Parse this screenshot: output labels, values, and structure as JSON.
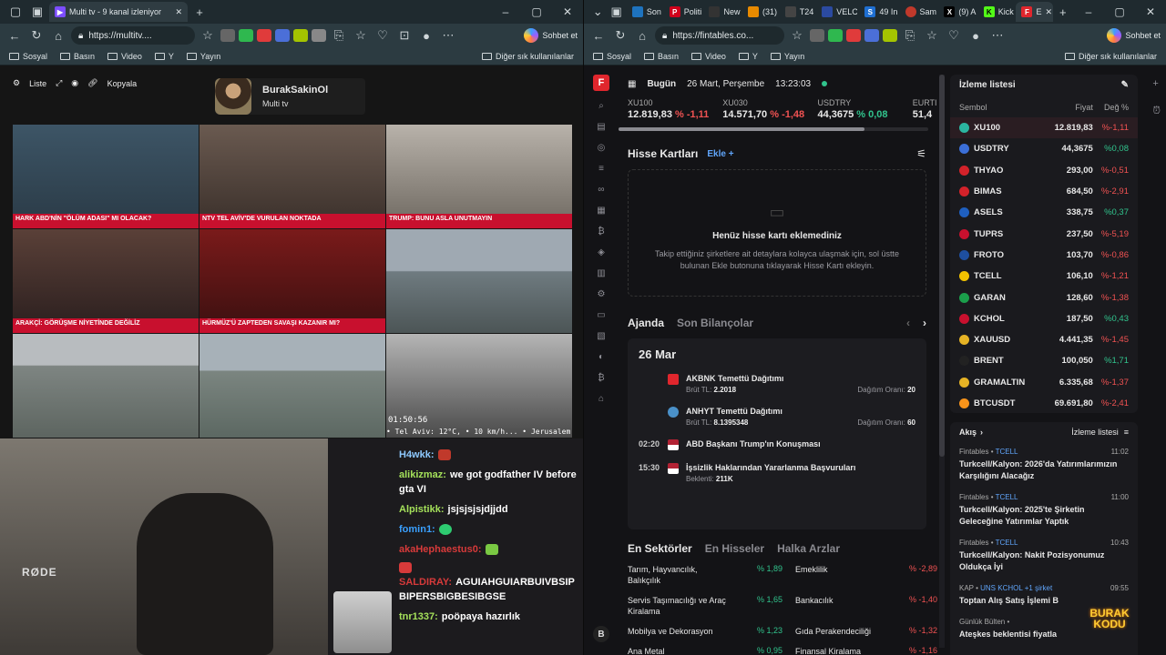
{
  "left_browser": {
    "tab_title": "Multi tv - 9 kanal izleniyor",
    "url": "https://multitv....",
    "chat_label": "Sohbet et",
    "bookmarks": [
      "Sosyal",
      "Basın",
      "Video",
      "Y",
      "Yayın"
    ],
    "other_bookmarks": "Diğer sık kullanılanlar"
  },
  "multitv": {
    "tools": {
      "list": "Liste",
      "copy": "Kopyala"
    },
    "user_name": "BurakSakinOl",
    "user_sub": "Multi tv",
    "cells": [
      {
        "lower": "HARK ABD'NİN \"ÖLÜM ADASI\" MI OLACAK?"
      },
      {
        "lower": "NTV TEL AVİV'DE VURULAN NOKTADA"
      },
      {
        "lower": "TRUMP: BUNU ASLA UNUTMAYIN"
      },
      {
        "lower": "ARAKÇİ: GÖRÜŞME NİYETİNDE DEĞİLİZ"
      },
      {
        "lower": "HÜRMÜZ'Ü ZAPTEDEN SAVAŞI KAZANIR MI?"
      }
    ],
    "clock": "01:50:56",
    "ticker": "• Tel Aviv: 12°C, • 10 km/h... • Jerusalem: 7°C, • 1"
  },
  "chat": [
    {
      "user": "H4wkk:",
      "color": "#8ec9ff",
      "text": ""
    },
    {
      "user": "alikizmaz:",
      "color": "#a4e05a",
      "text": "we got godfather IV before gta VI"
    },
    {
      "user": "Alpistikk:",
      "color": "#a4e05a",
      "text": "jsjsjsjsjdjjdd"
    },
    {
      "user": "fomin1:",
      "color": "#3aa0ff",
      "text": ""
    },
    {
      "user": "akaHephaestus0:",
      "color": "#d73a3a",
      "text": ""
    },
    {
      "user": "SALDIRAY:",
      "color": "#d73a3a",
      "text": "AGUIAHGUIARBUIVBSIPBIPERSBIGBESIBGSE"
    },
    {
      "user": "tnr1337:",
      "color": "#a4e05a",
      "text": "poöpaya hazırlık"
    }
  ],
  "cam_label": "RØDE",
  "right_browser": {
    "tab_labels": [
      "Son",
      "Politi",
      "New",
      "(31)",
      "T24",
      "VELC",
      "49 In",
      "Sam",
      "(9) A",
      "Kick",
      "E"
    ],
    "url": "https://fintables.co...",
    "chat_label": "Sohbet et",
    "bookmarks": [
      "Sosyal",
      "Basın",
      "Video",
      "Y",
      "Yayın"
    ],
    "other_bookmarks": "Diğer sık kullanılanlar"
  },
  "fintables": {
    "logo": "F",
    "today": "Bugün",
    "date": "26 Mart, Perşembe",
    "time": "13:23:03",
    "tickers": [
      {
        "name": "XU100",
        "value": "12.819,83",
        "change": "% -1,11",
        "dir": "down"
      },
      {
        "name": "XU030",
        "value": "14.571,70",
        "change": "% -1,48",
        "dir": "down"
      },
      {
        "name": "USDTRY",
        "value": "44,3675",
        "change": "% 0,08",
        "dir": "up"
      },
      {
        "name": "EURTI",
        "value": "51,4",
        "change": "",
        "dir": "up"
      }
    ],
    "cards_title": "Hisse Kartları",
    "cards_add": "Ekle",
    "empty_title": "Henüz hisse kartı eklemediniz",
    "empty_desc": "Takip ettiğiniz şirketlere ait detaylara kolayca ulaşmak için, sol üstte bulunan Ekle butonuna tıklayarak Hisse Kartı ekleyin.",
    "agenda_tab": "Ajanda",
    "balance_tab": "Son Bilançolar",
    "agenda_date": "26 Mar",
    "events": [
      {
        "time": "",
        "title": "AKBNK Temettü Dağıtımı",
        "sub_label": "Brüt TL:",
        "sub_val": "2.2018",
        "right_label": "Dağıtım Oranı:",
        "right_val": "20",
        "icon": "#e0262d"
      },
      {
        "time": "",
        "title": "ANHYT Temettü Dağıtımı",
        "sub_label": "Brüt TL:",
        "sub_val": "8.1395348",
        "right_label": "Dağıtım Oranı:",
        "right_val": "60",
        "icon": "#4a90c8"
      },
      {
        "time": "02:20",
        "title": "ABD Başkanı Trump'ın Konuşması",
        "sub_label": "",
        "sub_val": "",
        "right_label": "",
        "right_val": "",
        "icon": "#b22234"
      },
      {
        "time": "15:30",
        "title": "İşsizlik Haklarından Yararlanma Başvuruları",
        "sub_label": "Beklenti:",
        "sub_val": "211K",
        "right_label": "",
        "right_val": "",
        "icon": "#b22234"
      }
    ],
    "sector_tabs": [
      "En Sektörler",
      "En Hisseler",
      "Halka Arzlar"
    ],
    "sectors": [
      {
        "a": "Tarım, Hayvancılık, Balıkçılık",
        "av": "% 1,89",
        "b": "Emeklilik",
        "bv": "% -2,89"
      },
      {
        "a": "Servis Taşımacılığı ve Araç Kiralama",
        "av": "% 1,65",
        "b": "Bankacılık",
        "bv": "% -1,40"
      },
      {
        "a": "Mobilya ve Dekorasyon",
        "av": "% 1,23",
        "b": "Gıda Perakendeciliği",
        "bv": "% -1,32"
      },
      {
        "a": "Ana Metal",
        "av": "% 0,95",
        "b": "Finansal Kiralama",
        "bv": "% -1,16"
      }
    ],
    "watchlist_title": "İzleme listesi",
    "watch_cols": [
      "Sembol",
      "Fiyat",
      "Değ %"
    ],
    "watchlist": [
      {
        "sym": "XU100",
        "price": "12.819,83",
        "chg": "%-1,11",
        "dir": "down",
        "color": "#2bb5a0"
      },
      {
        "sym": "USDTRY",
        "price": "44,3675",
        "chg": "%0,08",
        "dir": "up",
        "color": "#3b6fd8"
      },
      {
        "sym": "THYAO",
        "price": "293,00",
        "chg": "%-0,51",
        "dir": "down",
        "color": "#d3222a"
      },
      {
        "sym": "BIMAS",
        "price": "684,50",
        "chg": "%-2,91",
        "dir": "down",
        "color": "#d3222a"
      },
      {
        "sym": "ASELS",
        "price": "338,75",
        "chg": "%0,37",
        "dir": "up",
        "color": "#1f5fbf"
      },
      {
        "sym": "TUPRS",
        "price": "237,50",
        "chg": "%-5,19",
        "dir": "down",
        "color": "#c8102e"
      },
      {
        "sym": "FROTO",
        "price": "103,70",
        "chg": "%-0,86",
        "dir": "down",
        "color": "#1e4fa0"
      },
      {
        "sym": "TCELL",
        "price": "106,10",
        "chg": "%-1,21",
        "dir": "down",
        "color": "#f2c200"
      },
      {
        "sym": "GARAN",
        "price": "128,60",
        "chg": "%-1,38",
        "dir": "down",
        "color": "#1b9e4b"
      },
      {
        "sym": "KCHOL",
        "price": "187,50",
        "chg": "%0,43",
        "dir": "up",
        "color": "#c8102e"
      },
      {
        "sym": "XAUUSD",
        "price": "4.441,35",
        "chg": "%-1,45",
        "dir": "down",
        "color": "#e6b325"
      },
      {
        "sym": "BRENT",
        "price": "100,050",
        "chg": "%1,71",
        "dir": "up",
        "color": "#222"
      },
      {
        "sym": "GRAMALTIN",
        "price": "6.335,68",
        "chg": "%-1,37",
        "dir": "down",
        "color": "#e6b325"
      },
      {
        "sym": "BTCUSDT",
        "price": "69.691,80",
        "chg": "%-2,41",
        "dir": "down",
        "color": "#f7931a"
      }
    ],
    "flow_title": "Akış",
    "flow_watch": "İzleme listesi",
    "news": [
      {
        "src": "Fintables",
        "tag": "TCELL",
        "time": "11:02",
        "hl": "Turkcell/Kalyon: 2026'da Yatırımlarımızın Karşılığını Alacağız"
      },
      {
        "src": "Fintables",
        "tag": "TCELL",
        "time": "11:00",
        "hl": "Turkcell/Kalyon: 2025'te Şirketin Geleceğine Yatırımlar Yaptık"
      },
      {
        "src": "Fintables",
        "tag": "TCELL",
        "time": "10:43",
        "hl": "Turkcell/Kalyon: Nakit Pozisyonumuz Oldukça İyi"
      },
      {
        "src": "KAP",
        "tag": "UNS KCHOL +1 şirket",
        "time": "09:55",
        "hl": "Toptan Alış Satış İşlemi B"
      },
      {
        "src": "Günlük Bülten",
        "tag": "",
        "time": "",
        "hl": "Ateşkes beklentisi fiyatla"
      }
    ],
    "bottom_logo": "B"
  },
  "brand_overlay": "BURAK KODU"
}
